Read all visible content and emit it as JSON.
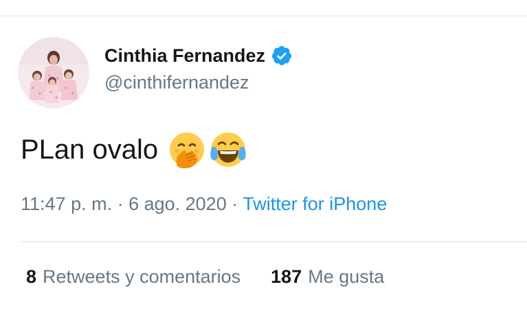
{
  "tweet": {
    "author": {
      "display_name": "Cinthia Fernandez",
      "handle": "@cinthifernandez",
      "verified": true,
      "verified_icon": "verified-badge-icon",
      "avatar": "profile-photo"
    },
    "text": "PLan ovalo",
    "emojis": [
      "face-with-hand-over-mouth",
      "face-with-tears-of-joy"
    ],
    "time": "11:47 p. m.",
    "separator": " · ",
    "date": "6 ago. 2020",
    "source": "Twitter for iPhone",
    "stats": {
      "retweets_count": "8",
      "retweets_label": "Retweets y comentarios",
      "likes_count": "187",
      "likes_label": "Me gusta"
    }
  },
  "colors": {
    "text_primary": "#14171a",
    "text_secondary": "#657786",
    "link": "#1b95e0",
    "verified": "#1da1f2",
    "divider": "#e6ecf0"
  }
}
